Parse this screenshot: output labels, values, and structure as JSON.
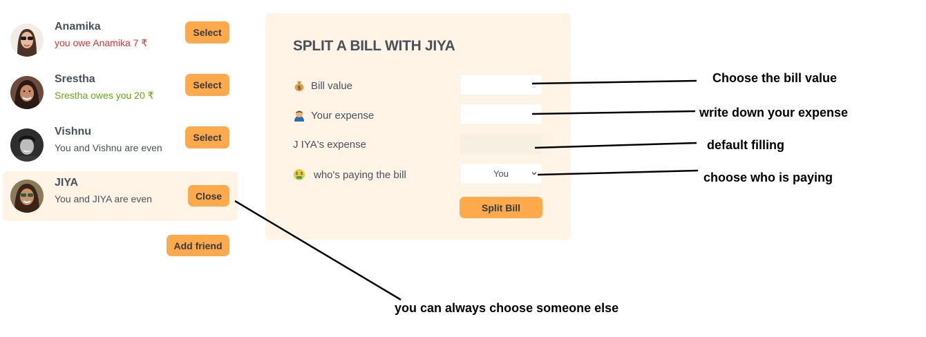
{
  "friends": [
    {
      "name": "Anamika",
      "status": "you owe Anamika 7 ₹",
      "button": "Select"
    },
    {
      "name": "Srestha",
      "status": "Srestha owes you 20 ₹",
      "button": "Select"
    },
    {
      "name": "Vishnu",
      "status": "You and Vishnu are even",
      "button": "Select"
    },
    {
      "name": "JIYA",
      "status": "You and JIYA are even",
      "button": "Close"
    }
  ],
  "add_friend_label": "Add friend",
  "form": {
    "title": "SPLIT A BILL WITH JIYA",
    "bill_label": "Bill value",
    "expense_label": "Your expense",
    "friend_expense_label": "J IYA's expense",
    "payer_label": "who's paying the bill",
    "payer_selected": "You",
    "submit_label": "Split Bill"
  },
  "annotations": {
    "bill": "Choose the bill value",
    "expense": "write down your expense",
    "default": "default filling",
    "payer": "choose who is paying",
    "someone_else": "you can always choose someone else"
  },
  "icons": {
    "bill": "money-bag-icon",
    "expense": "person-icon",
    "payer": "money-mouth-face-icon",
    "chevron": "chevron-down-icon"
  },
  "colors": {
    "accent": "#ffa94d",
    "panel": "#fff4e6",
    "owe_red": "#e03131",
    "owed_green": "#66a80f",
    "text": "#495057"
  }
}
